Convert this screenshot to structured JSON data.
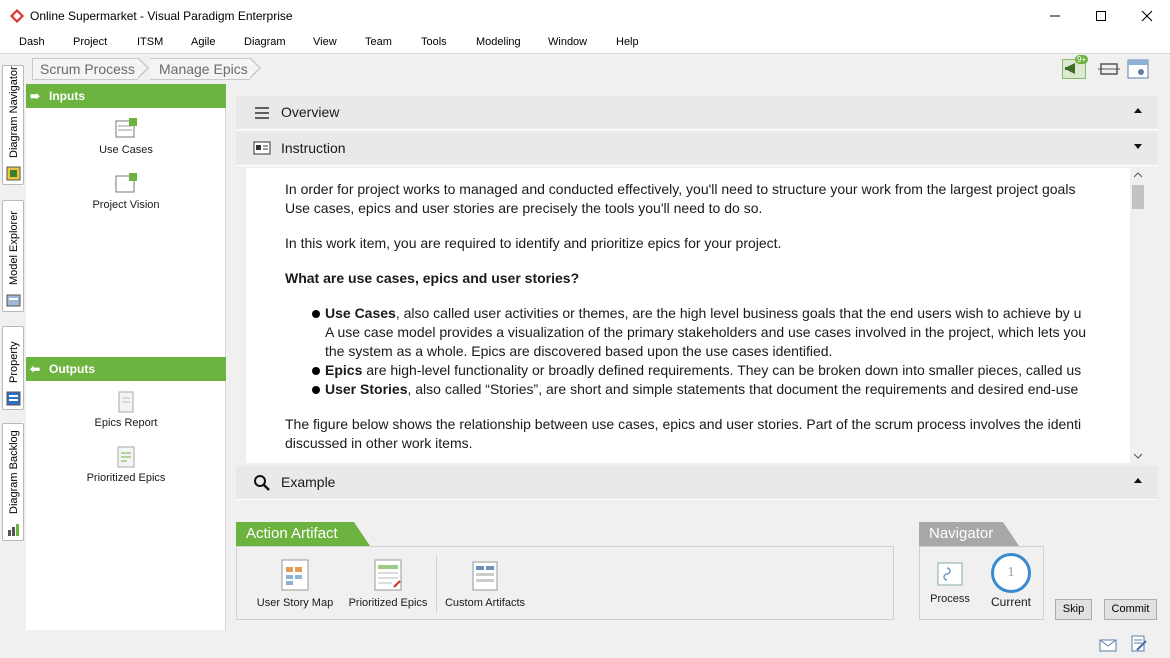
{
  "window": {
    "title": "Online Supermarket - Visual Paradigm Enterprise",
    "minimize_icon": "minimize-icon",
    "maximize_icon": "maximize-icon",
    "close_icon": "close-icon"
  },
  "menu": [
    "Dash",
    "Project",
    "ITSM",
    "Agile",
    "Diagram",
    "View",
    "Team",
    "Tools",
    "Modeling",
    "Window",
    "Help"
  ],
  "left_tabs": [
    "Diagram Navigator",
    "Model Explorer",
    "Property",
    "Diagram Backlog"
  ],
  "breadcrumb": [
    "Scrum Process",
    "Manage Epics"
  ],
  "toolbar_right": {
    "notification_badge": "9+"
  },
  "left_panel": {
    "inputs_title": "Inputs",
    "inputs": [
      "Use Cases",
      "Project Vision"
    ],
    "outputs_title": "Outputs",
    "outputs": [
      "Epics Report",
      "Prioritized Epics"
    ]
  },
  "main": {
    "overview_title": "Overview",
    "instruction_title": "Instruction",
    "example_title": "Example",
    "instruction": {
      "p1_line1": "In order for project works to managed and conducted effectively, you'll need to structure your work from the largest project goals",
      "p1_line2": "Use cases, epics and user stories are precisely the tools you'll need to do so.",
      "p2": "In this work item, you are required to identify and prioritize epics for your project.",
      "heading": "What are use cases, epics and user stories?",
      "b1_term": "Use Cases",
      "b1_line1": ", also called user activities or themes, are the high level business goals that the end users wish to achieve by u",
      "b1_line2": "A use case model provides a visualization of the primary stakeholders and use cases involved in the project, which lets you",
      "b1_line3": "the system as a whole. Epics are discovered based upon the use cases identified.",
      "b2_term": "Epics",
      "b2_text": " are high-level functionality or broadly defined requirements. They can be broken down into smaller pieces, called us",
      "b3_term": "User Stories",
      "b3_text": ", also called “Stories”, are short and simple statements that document the requirements and desired end-use",
      "p3_line1": "The figure below shows the relationship between use cases, epics and user stories. Part of the scrum process involves the identi",
      "p3_line2": "discussed in other work items."
    }
  },
  "action_artifact": {
    "title": "Action Artifact",
    "items": [
      "User Story Map",
      "Prioritized Epics",
      "Custom Artifacts"
    ]
  },
  "navigator": {
    "title": "Navigator",
    "process_label": "Process",
    "current_label": "Current",
    "current_number": "1"
  },
  "buttons": {
    "skip": "Skip",
    "commit": "Commit"
  },
  "colors": {
    "green": "#6cb33f",
    "navigator_gray": "#a8a8a8",
    "current_ring": "#3a8ad0"
  }
}
